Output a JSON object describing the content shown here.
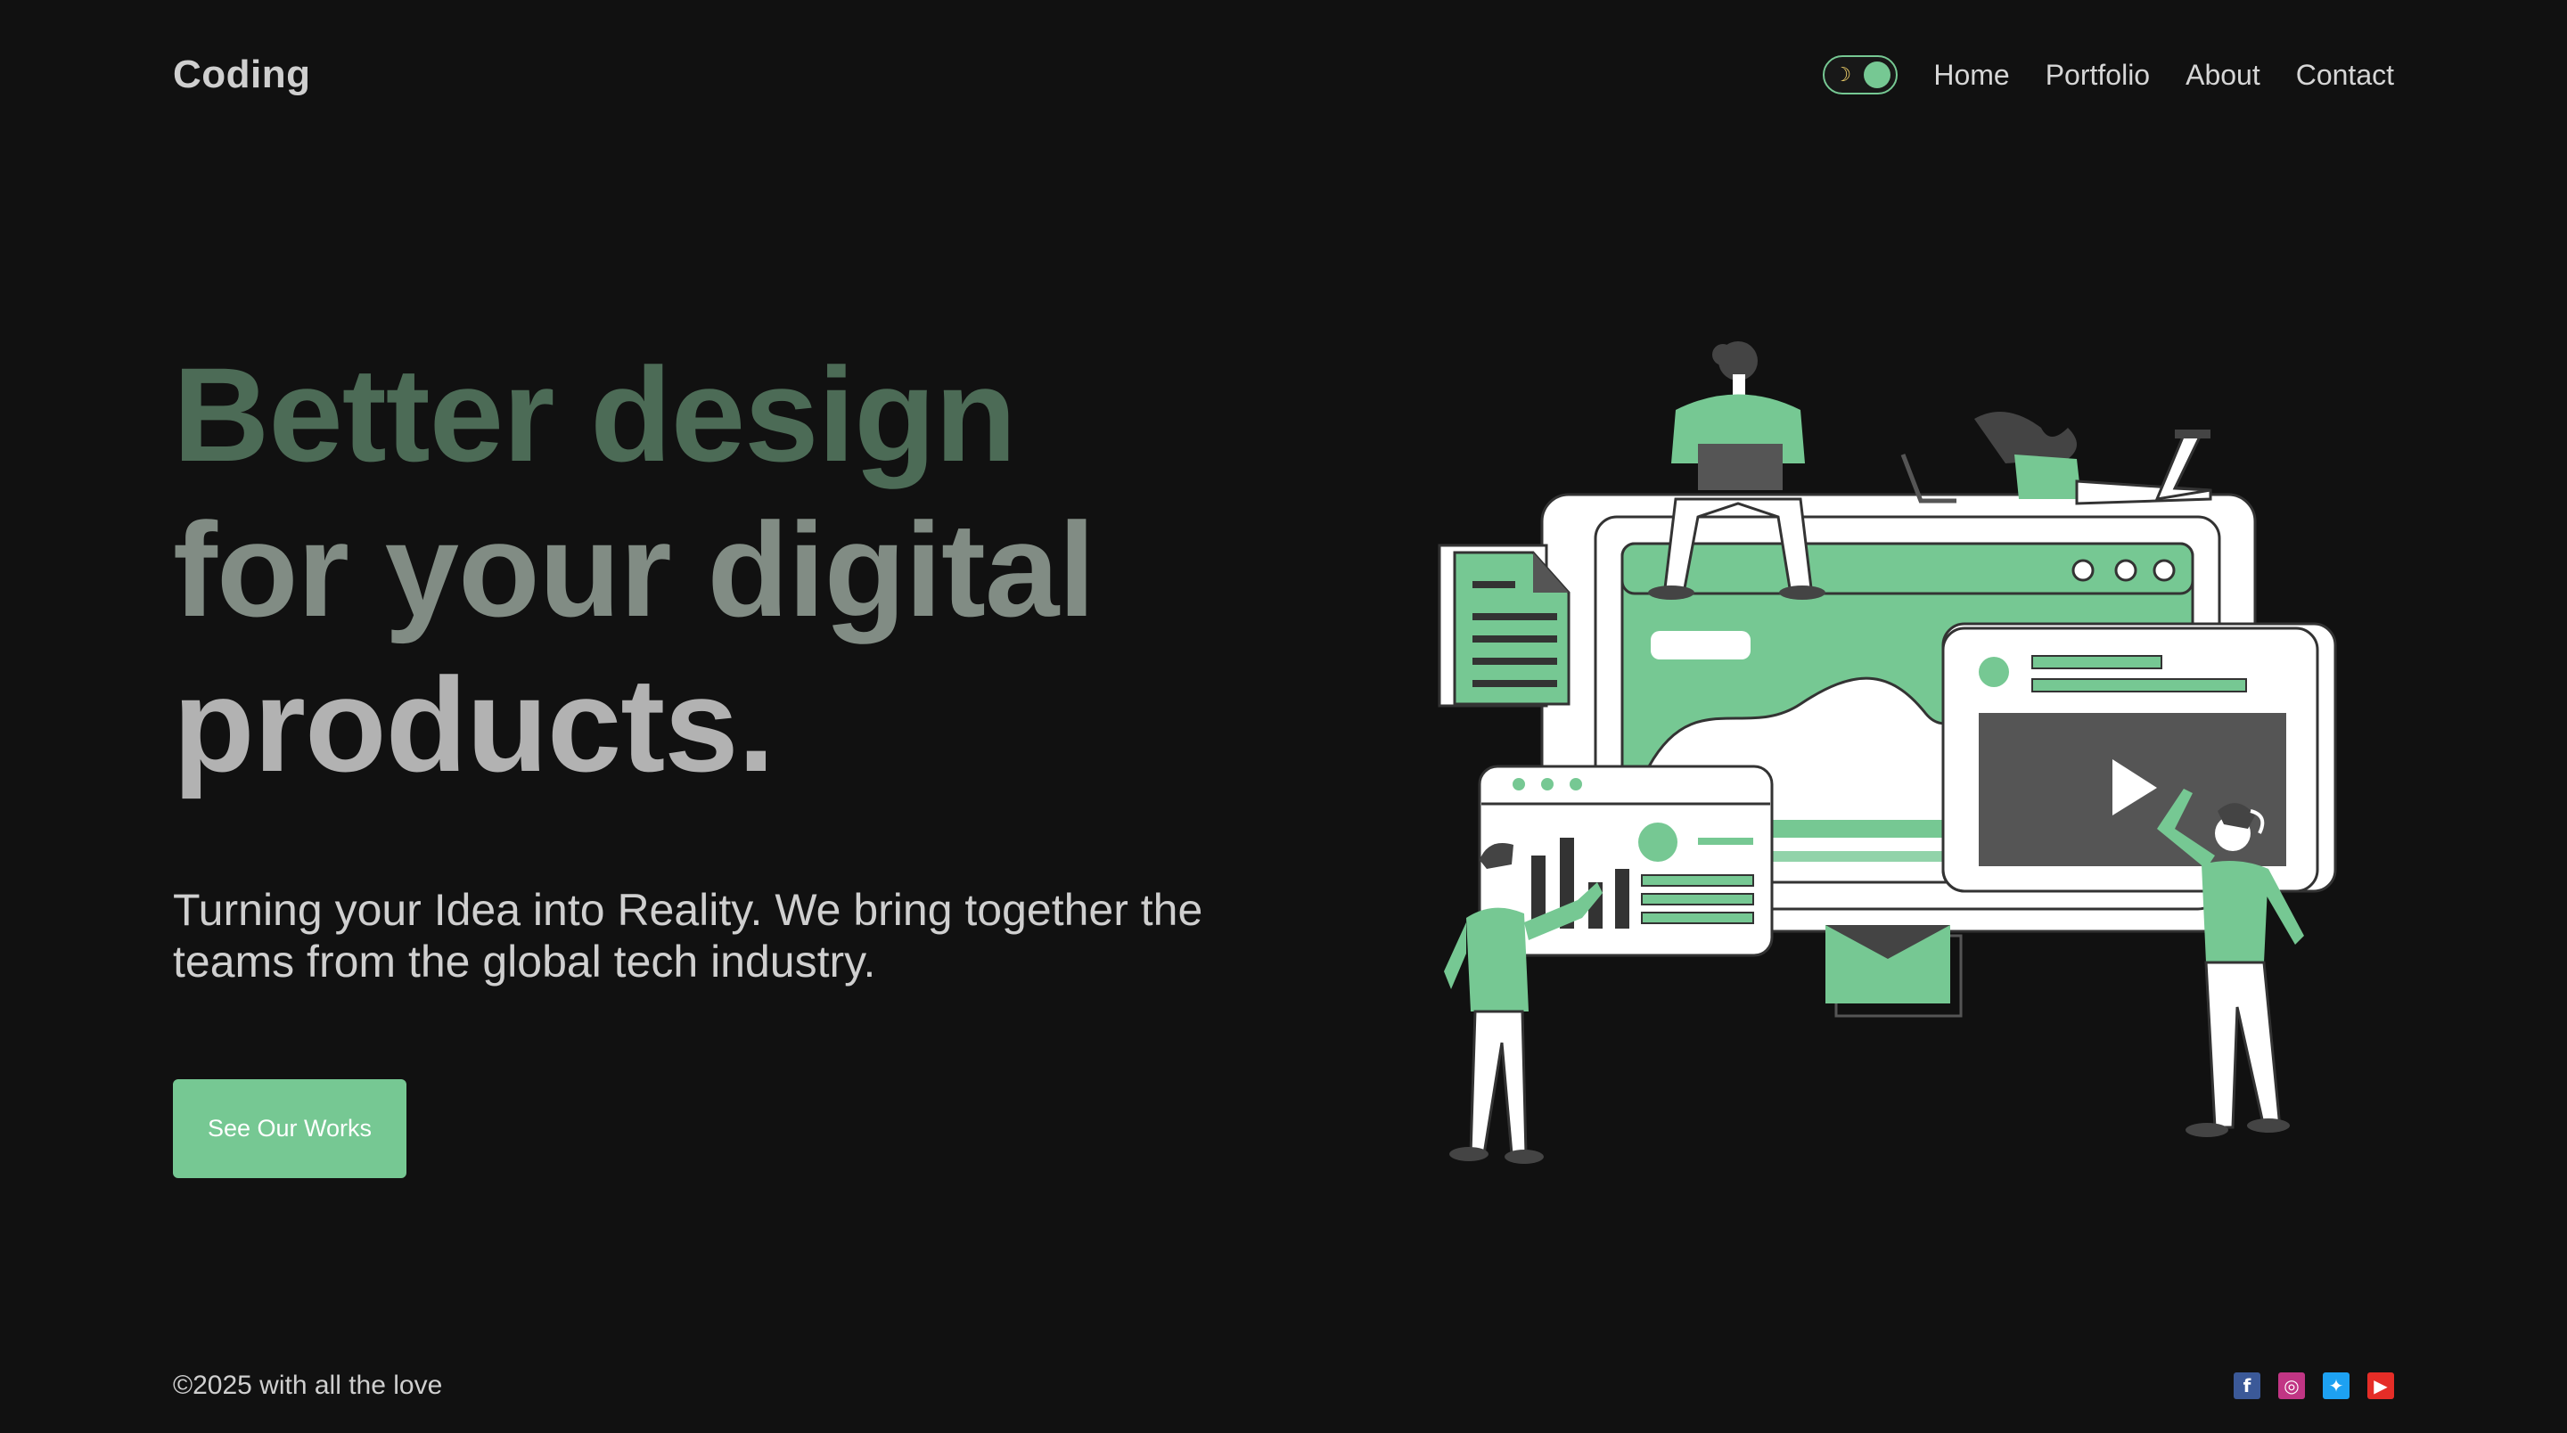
{
  "brand": {
    "name": "Coding"
  },
  "nav": {
    "theme_toggle": {
      "icon": "moon-icon",
      "state": "dark"
    },
    "links": [
      {
        "label": "Home"
      },
      {
        "label": "Portfolio"
      },
      {
        "label": "About"
      },
      {
        "label": "Contact"
      }
    ]
  },
  "hero": {
    "title_lines": [
      "Better design",
      "for your digital",
      "products."
    ],
    "subtitle": "Turning your Idea into Reality. We bring together the teams from the global tech industry.",
    "cta_label": "See Our Works"
  },
  "footer": {
    "copyright": "©2025 with all the love",
    "socials": [
      {
        "name": "facebook-icon",
        "glyph": "f",
        "color": "#3b5998"
      },
      {
        "name": "instagram-icon",
        "glyph": "◎",
        "color": "#c13584"
      },
      {
        "name": "twitter-icon",
        "glyph": "✦",
        "color": "#1da1f2"
      },
      {
        "name": "youtube-icon",
        "glyph": "▶",
        "color": "#e52d27"
      }
    ]
  },
  "colors": {
    "background": "#111111",
    "accent": "#76c893",
    "title_line1": "#4c6b56",
    "title_line2": "#818c84",
    "title_line3": "#b2b2b2"
  }
}
